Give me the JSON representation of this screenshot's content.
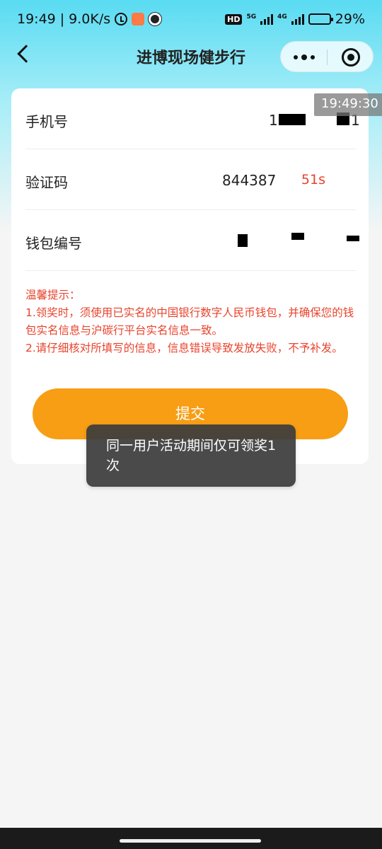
{
  "status_bar": {
    "time": "19:49",
    "net_speed": "9.0K/s",
    "hd_label": "HD",
    "net_5g": "5G",
    "net_4g": "4G",
    "battery": "29%"
  },
  "nav": {
    "title": "进博现场健步行"
  },
  "form": {
    "phone_label": "手机号",
    "phone_value_partial": "1",
    "phone_value_end": "1",
    "code_label": "验证码",
    "code_value": "844387",
    "code_countdown": "51s",
    "wallet_label": "钱包编号"
  },
  "overlay_time": "19:49:30",
  "tips": {
    "title": "温馨提示：",
    "line1": "1.领奖时，须使用已实名的中国银行数字人民币钱包，并确保您的钱包实名信息与沪碳行平台实名信息一致。",
    "line2": "2.请仔细核对所填写的信息，信息错误导致发放失败，不予补发。"
  },
  "submit_label": "提交",
  "toast_text": "同一用户活动期间仅可领奖1次"
}
